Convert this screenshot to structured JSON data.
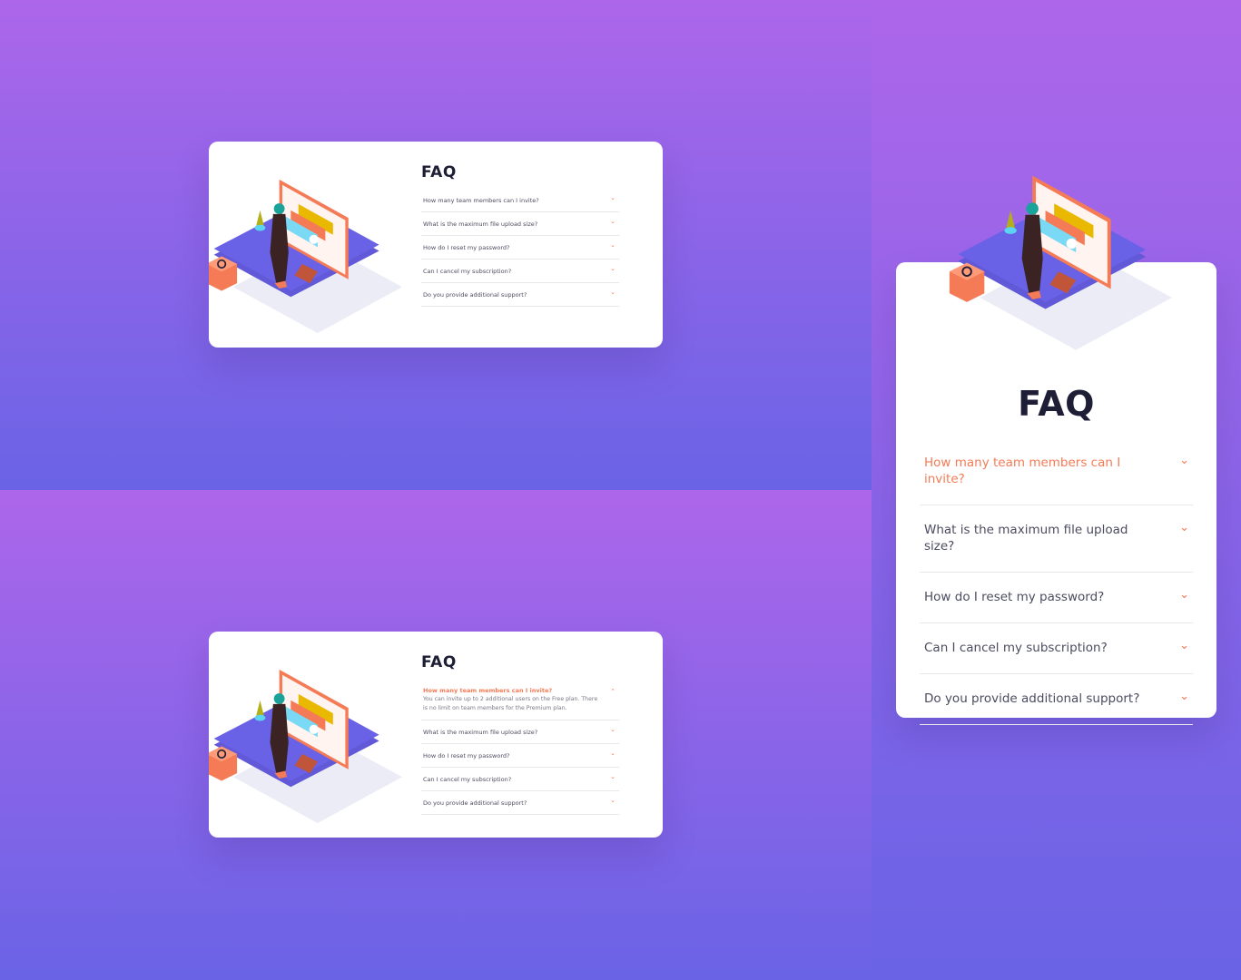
{
  "faq_title": "FAQ",
  "questions": [
    "How many team members can I invite?",
    "What is the maximum file upload size?",
    "How do I reset my password?",
    "Can I cancel my subscription?",
    "Do you provide additional support?"
  ],
  "answer_1": "You can invite up to 2 additional users on the Free plan. There is no limit on team members for the Premium plan.",
  "icons": {
    "expand": "chevron-down-icon",
    "collapse": "chevron-up-icon"
  },
  "colors": {
    "accent": "#f47b56",
    "title": "#1e1f36",
    "text": "#4b4c5f",
    "bg_top": "#ad66ea",
    "bg_bottom": "#6a63e6",
    "platform": "#6961e6",
    "monitor": "#f47b56"
  }
}
